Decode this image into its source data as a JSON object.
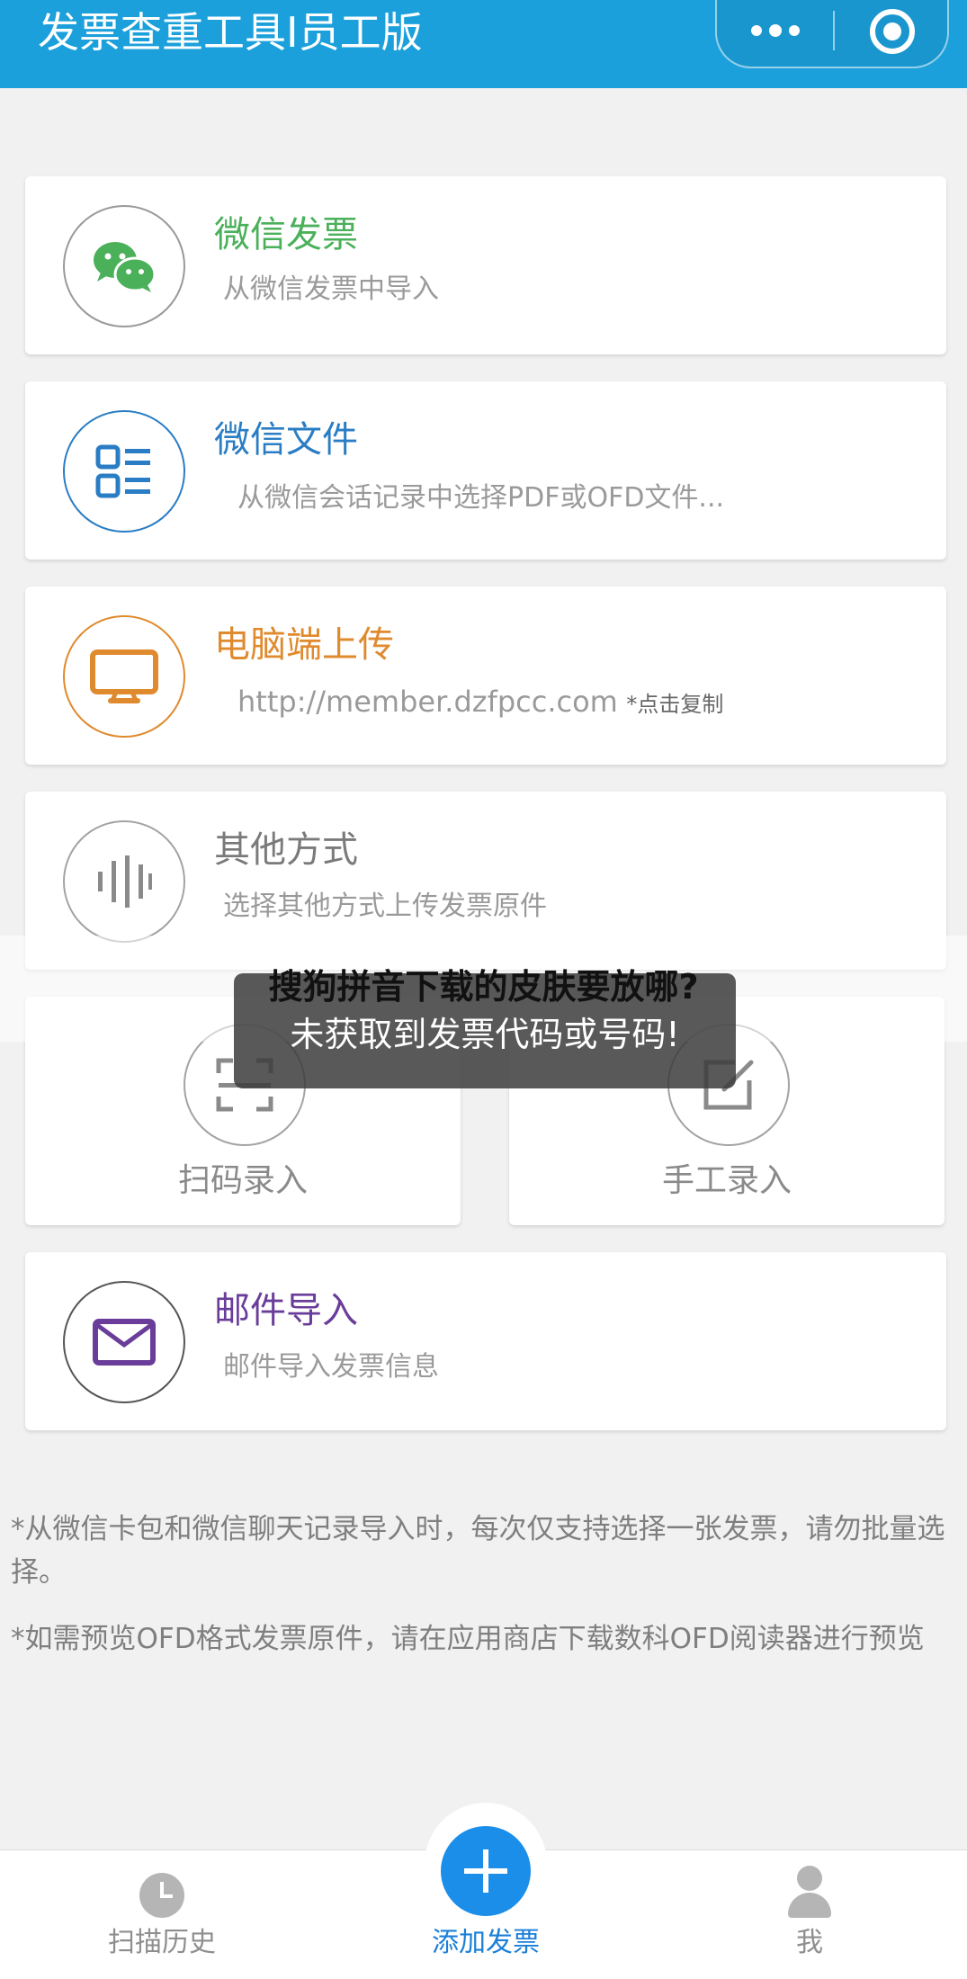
{
  "header": {
    "title": "发票查重工具I员工版",
    "more_icon": "more-dots-icon",
    "close_icon": "target-close-icon"
  },
  "colors": {
    "header_bg": "#1ba0db",
    "wechat_green": "#4bb05a",
    "file_blue": "#2a7dc4",
    "pc_orange": "#e08a2e",
    "other_gray": "#8a8a8a",
    "mail_purple": "#6a3d9a",
    "fab_blue": "#1b8ee9"
  },
  "import_options": [
    {
      "title": "微信发票",
      "subtitle": "从微信发票中导入",
      "icon": "wechat-icon"
    },
    {
      "title": "微信文件",
      "subtitle": "从微信会话记录中选择PDF或OFD文件...",
      "icon": "file-list-icon"
    },
    {
      "title": "电脑端上传",
      "subtitle": "http://member.dzfpcc.com",
      "subtitle_note": "*点击复制",
      "icon": "monitor-icon"
    },
    {
      "title": "其他方式",
      "subtitle": "选择其他方式上传发票原件",
      "icon": "soundwave-icon"
    }
  ],
  "quick_actions": [
    {
      "label": "扫码录入",
      "icon": "scan-icon"
    },
    {
      "label": "手工录入",
      "icon": "edit-icon"
    }
  ],
  "mail_option": {
    "title": "邮件导入",
    "subtitle": "邮件导入发票信息",
    "icon": "mail-icon"
  },
  "notes": [
    "*从微信卡包和微信聊天记录导入时，每次仅支持选择一张发票，请勿批量选择。",
    "*如需预览OFD格式发票原件，请在应用商店下载数科OFD阅读器进行预览"
  ],
  "overlay": {
    "headline": "搜狗拼音下载的皮肤要放哪?",
    "toast": "未获取到发票代码或号码!"
  },
  "tabbar": {
    "items": [
      {
        "label": "扫描历史",
        "icon": "clock-icon",
        "active": false
      },
      {
        "label": "添加发票",
        "icon": "plus-icon",
        "active": true
      },
      {
        "label": "我",
        "icon": "person-icon",
        "active": false
      }
    ]
  }
}
